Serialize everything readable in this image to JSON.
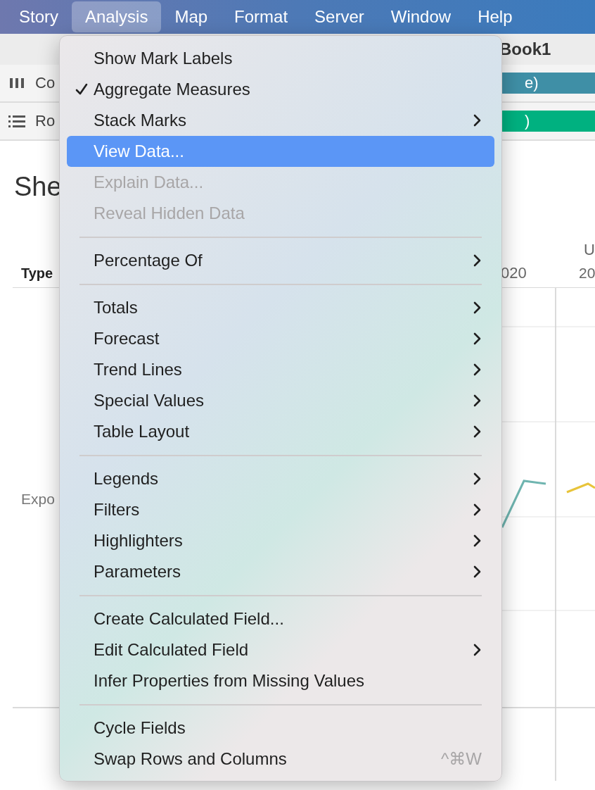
{
  "menu_bar": {
    "items": [
      {
        "label": "Story",
        "selected": false
      },
      {
        "label": "Analysis",
        "selected": true
      },
      {
        "label": "Map",
        "selected": false
      },
      {
        "label": "Format",
        "selected": false
      },
      {
        "label": "Server",
        "selected": false
      },
      {
        "label": "Window",
        "selected": false
      },
      {
        "label": "Help",
        "selected": false
      }
    ]
  },
  "toolbar": {
    "title": "Book1"
  },
  "shelves": [
    {
      "kind": "columns",
      "label": "Co",
      "pill": "e)",
      "color": "#3f8fa6"
    },
    {
      "kind": "rows",
      "label": "Ro",
      "pill": ")",
      "color": "#00b180"
    }
  ],
  "sheet": {
    "title": "She",
    "header_top": [
      "U"
    ],
    "row_header": "Type",
    "column_headers": [
      "020",
      "20"
    ],
    "row_label": "Expo"
  },
  "menu": {
    "items": [
      {
        "kind": "item",
        "label": "Show Mark Labels",
        "checked": false,
        "disabled": false,
        "selected": false,
        "submenu": false
      },
      {
        "kind": "item",
        "label": "Aggregate Measures",
        "checked": true,
        "disabled": false,
        "selected": false,
        "submenu": false
      },
      {
        "kind": "item",
        "label": "Stack Marks",
        "checked": false,
        "disabled": false,
        "selected": false,
        "submenu": true
      },
      {
        "kind": "item",
        "label": "View Data...",
        "checked": false,
        "disabled": false,
        "selected": true,
        "submenu": false
      },
      {
        "kind": "item",
        "label": "Explain Data...",
        "checked": false,
        "disabled": true,
        "selected": false,
        "submenu": false
      },
      {
        "kind": "item",
        "label": "Reveal Hidden Data",
        "checked": false,
        "disabled": true,
        "selected": false,
        "submenu": false
      },
      {
        "kind": "separator"
      },
      {
        "kind": "item",
        "label": "Percentage Of",
        "checked": false,
        "disabled": false,
        "selected": false,
        "submenu": true
      },
      {
        "kind": "separator"
      },
      {
        "kind": "item",
        "label": "Totals",
        "checked": false,
        "disabled": false,
        "selected": false,
        "submenu": true
      },
      {
        "kind": "item",
        "label": "Forecast",
        "checked": false,
        "disabled": false,
        "selected": false,
        "submenu": true
      },
      {
        "kind": "item",
        "label": "Trend Lines",
        "checked": false,
        "disabled": false,
        "selected": false,
        "submenu": true
      },
      {
        "kind": "item",
        "label": "Special Values",
        "checked": false,
        "disabled": false,
        "selected": false,
        "submenu": true
      },
      {
        "kind": "item",
        "label": "Table Layout",
        "checked": false,
        "disabled": false,
        "selected": false,
        "submenu": true
      },
      {
        "kind": "separator"
      },
      {
        "kind": "item",
        "label": "Legends",
        "checked": false,
        "disabled": false,
        "selected": false,
        "submenu": true
      },
      {
        "kind": "item",
        "label": "Filters",
        "checked": false,
        "disabled": false,
        "selected": false,
        "submenu": true
      },
      {
        "kind": "item",
        "label": "Highlighters",
        "checked": false,
        "disabled": false,
        "selected": false,
        "submenu": true
      },
      {
        "kind": "item",
        "label": "Parameters",
        "checked": false,
        "disabled": false,
        "selected": false,
        "submenu": true
      },
      {
        "kind": "separator"
      },
      {
        "kind": "item",
        "label": "Create Calculated Field...",
        "checked": false,
        "disabled": false,
        "selected": false,
        "submenu": false
      },
      {
        "kind": "item",
        "label": "Edit Calculated Field",
        "checked": false,
        "disabled": false,
        "selected": false,
        "submenu": true
      },
      {
        "kind": "item",
        "label": "Infer Properties from Missing Values",
        "checked": false,
        "disabled": false,
        "selected": false,
        "submenu": false
      },
      {
        "kind": "separator"
      },
      {
        "kind": "item",
        "label": "Cycle Fields",
        "checked": false,
        "disabled": false,
        "selected": false,
        "submenu": false
      },
      {
        "kind": "item",
        "label": "Swap Rows and Columns",
        "checked": false,
        "disabled": false,
        "selected": false,
        "submenu": false,
        "shortcut": "^⌘W"
      }
    ]
  }
}
